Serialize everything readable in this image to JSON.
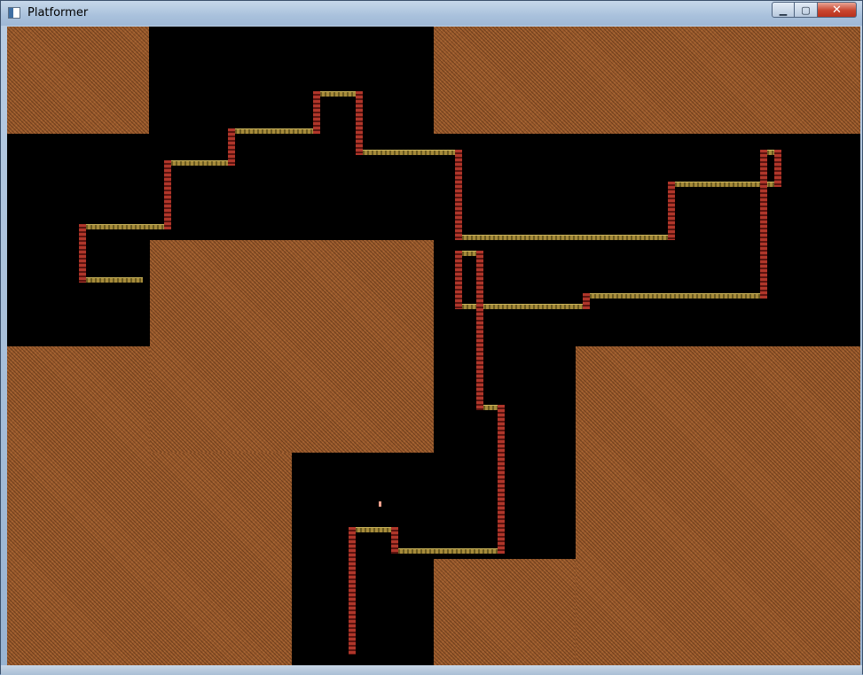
{
  "window": {
    "title": "Platformer",
    "minimize_label": "▁",
    "maximize_label": "▢",
    "close_label": "✕"
  },
  "colors": {
    "background": "#000000",
    "dirt": "#9a5a2c",
    "platform": "#a58a3a",
    "ladder": "#b0362a",
    "player": "#f3a08c"
  },
  "icons": {
    "app": "window-app-icon",
    "minimize": "minimize-icon",
    "maximize": "maximize-icon",
    "close": "close-icon"
  }
}
